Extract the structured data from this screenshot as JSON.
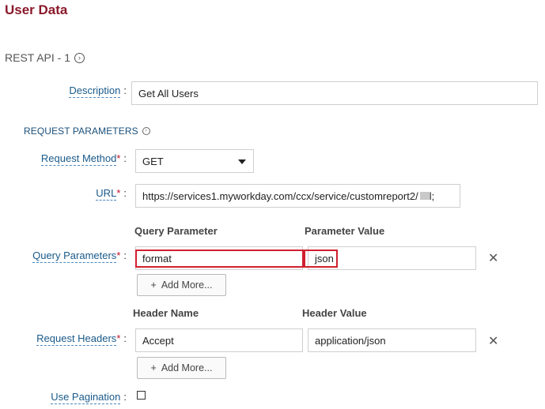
{
  "page": {
    "title": "User Data"
  },
  "section": {
    "title": "REST API - 1",
    "toggle_icon": "chevron-circle-icon"
  },
  "description": {
    "label": "Description",
    "value": "Get All Users"
  },
  "request_parameters": {
    "title": "REQUEST PARAMETERS"
  },
  "request_method": {
    "label": "Request Method",
    "value": "GET"
  },
  "url": {
    "label": "URL",
    "value": "https://services1.myworkday.com/ccx/service/customreport2/",
    "trailing": "l;"
  },
  "query_parameters": {
    "label": "Query Parameters",
    "col_name": "Query Parameter",
    "col_value": "Parameter Value",
    "rows": [
      {
        "name": "format",
        "value": "json"
      }
    ],
    "add_more": "Add More..."
  },
  "request_headers": {
    "label": "Request Headers",
    "col_name": "Header Name",
    "col_value": "Header Value",
    "rows": [
      {
        "name": "Accept",
        "value": "application/json"
      }
    ],
    "add_more": "Add More..."
  },
  "pagination": {
    "label": "Use Pagination",
    "checked": false
  },
  "glyphs": {
    "required": "*",
    "colon": ":",
    "remove": "✕",
    "plus": "+"
  },
  "colors": {
    "title": "#8b1a2b",
    "highlight": "#d0202e",
    "label": "#1a5a8a"
  }
}
